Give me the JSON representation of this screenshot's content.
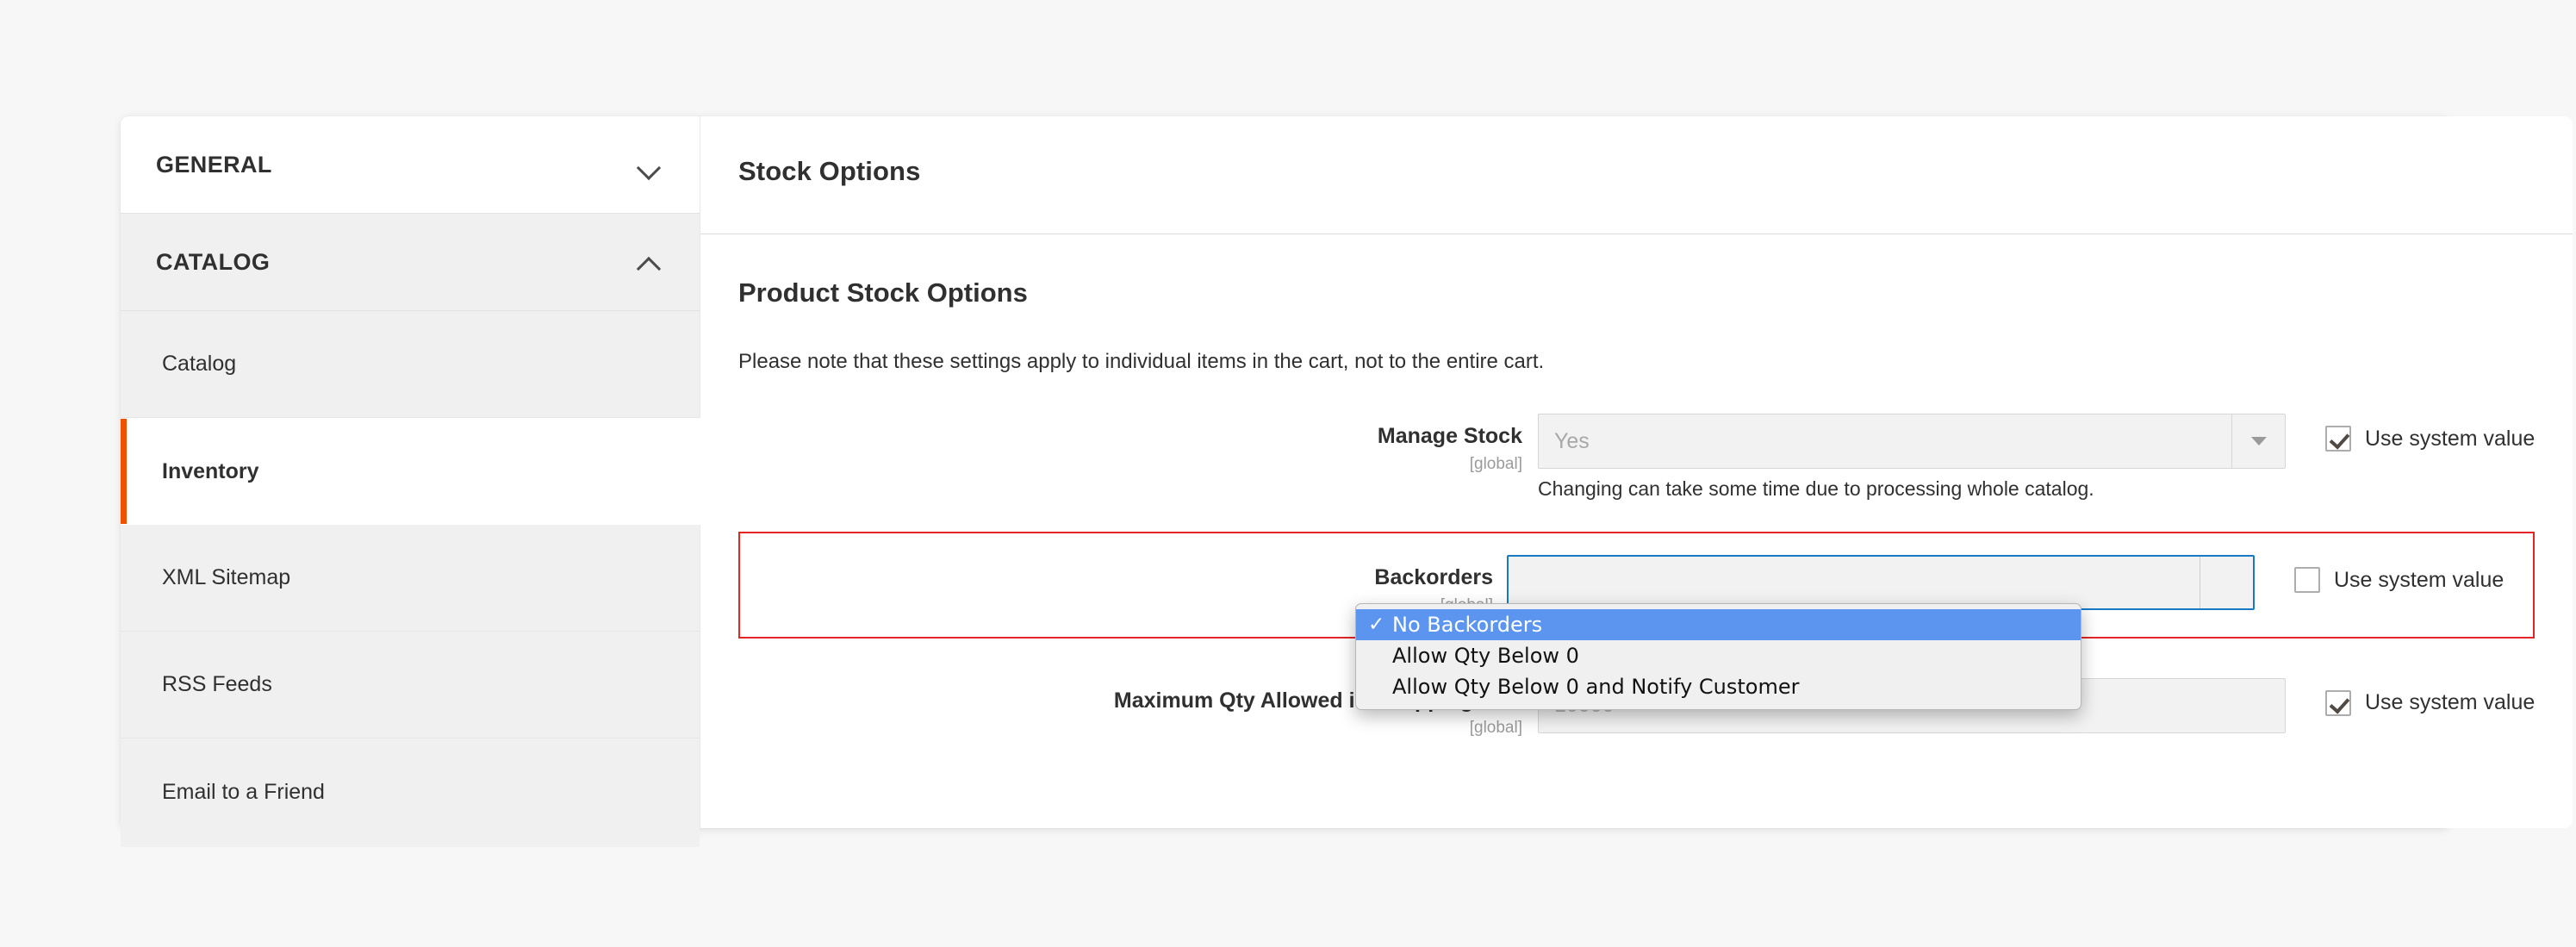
{
  "sidebar": {
    "sections": [
      {
        "title": "GENERAL",
        "expanded": false,
        "chevron": "chevron-down-icon",
        "items": []
      },
      {
        "title": "CATALOG",
        "expanded": true,
        "chevron": "chevron-up-icon",
        "items": [
          {
            "label": "Catalog",
            "active": false
          },
          {
            "label": "Inventory",
            "active": true
          },
          {
            "label": "XML Sitemap",
            "active": false
          },
          {
            "label": "RSS Feeds",
            "active": false
          },
          {
            "label": "Email to a Friend",
            "active": false
          }
        ]
      }
    ]
  },
  "main": {
    "page_title": "Stock Options",
    "section_title": "Product Stock Options",
    "note": "Please note that these settings apply to individual items in the cart, not to the entire cart.",
    "fields": [
      {
        "label": "Manage Stock",
        "scope": "[global]",
        "control": "select",
        "value": "Yes",
        "hint": "Changing can take some time due to processing whole catalog.",
        "use_system_value": {
          "label": "Use system value",
          "checked": true
        },
        "error": false
      },
      {
        "label": "Backorders",
        "scope": "[global]",
        "control": "select-open",
        "value": "No Backorders",
        "hint": "",
        "use_system_value": {
          "label": "Use system value",
          "checked": false
        },
        "error": true
      },
      {
        "label": "Maximum Qty Allowed in Shopping Cart",
        "scope": "[global]",
        "control": "input",
        "value": "10000",
        "hint": "",
        "use_system_value": {
          "label": "Use system value",
          "checked": true
        },
        "error": false
      }
    ]
  },
  "dropdown": {
    "open": true,
    "owner": "Backorders",
    "selected_index": 0,
    "checkmark": "✓",
    "options": [
      {
        "label": "No Backorders",
        "selected": true
      },
      {
        "label": "Allow Qty Below 0",
        "selected": false
      },
      {
        "label": "Allow Qty Below 0 and Notify Customer",
        "selected": false
      }
    ]
  },
  "colors": {
    "accent_orange": "#eb5202",
    "error_red": "#e22626",
    "focus_blue": "#1979c3",
    "highlight_blue": "#5b95f0",
    "page_bg": "#f7f7f7",
    "sidebar_bg": "#f0f0f0"
  }
}
